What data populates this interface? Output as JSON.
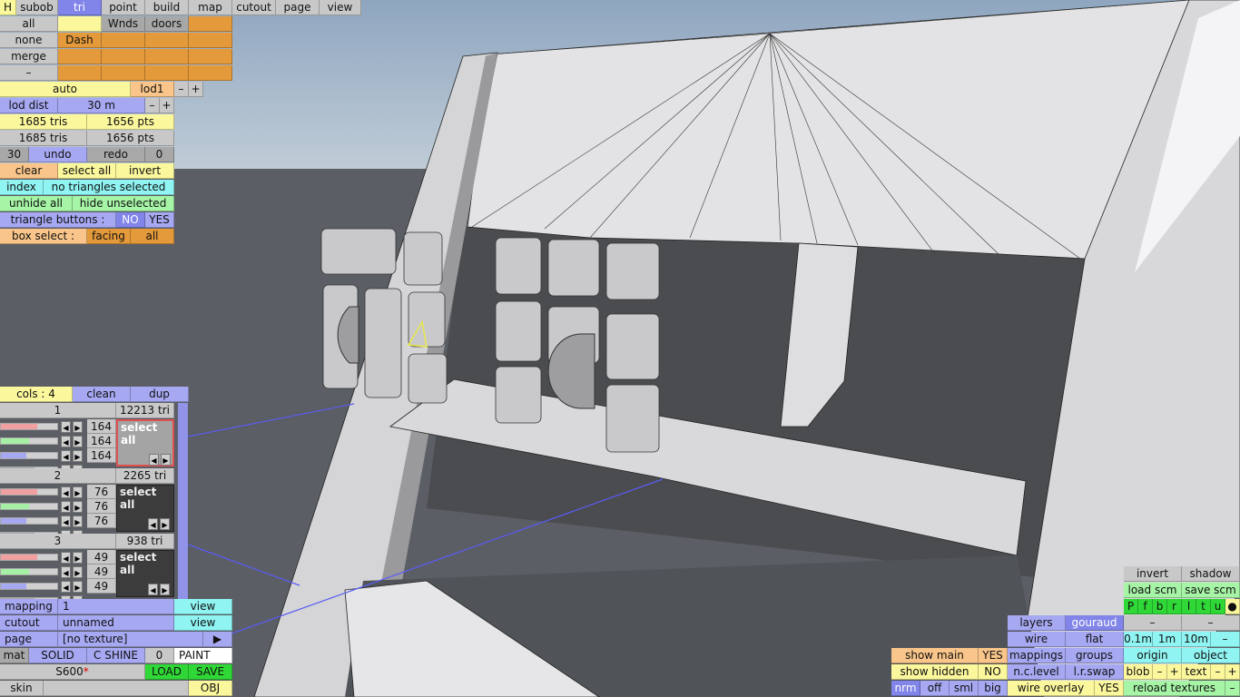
{
  "top_tabs": [
    "H",
    "subob",
    "tri",
    "point",
    "build",
    "map",
    "cutout",
    "page",
    "view"
  ],
  "sel_grid": {
    "all": "all",
    "wnds": "Wnds",
    "doors": "doors",
    "none": "none",
    "dash": "Dash",
    "merge": "merge",
    "minus": "–"
  },
  "lod": {
    "auto": "auto",
    "lod1": "lod1",
    "minus": "–",
    "plus": "+",
    "dist_label": "lod dist",
    "dist_value": "30 m"
  },
  "counts": {
    "tris1": "1685 tris",
    "pts1": "1656 pts",
    "tris2": "1685 tris",
    "pts2": "1656 pts"
  },
  "undo_row": {
    "num": "30",
    "undo": "undo",
    "redo": "redo",
    "zero": "0"
  },
  "sel_row": {
    "clear": "clear",
    "select_all": "select all",
    "invert": "invert"
  },
  "index_row": {
    "index": "index",
    "status": "no triangles selected"
  },
  "hide_row": {
    "unhide": "unhide all",
    "hide": "hide unselected"
  },
  "tri_buttons": {
    "label": "triangle buttons :",
    "no": "NO",
    "yes": "YES"
  },
  "box_select": {
    "label": "box select :",
    "facing": "facing",
    "all": "all"
  },
  "cols": {
    "label": "cols : 4",
    "clean": "clean",
    "dup": "dup"
  },
  "materials": [
    {
      "index": "1",
      "tris": "12213 tri",
      "v1": "164",
      "v2": "164",
      "v3": "164",
      "btn": "select all"
    },
    {
      "index": "2",
      "tris": "2265 tri",
      "v1": "76",
      "v2": "76",
      "v3": "76",
      "btn": "select all"
    },
    {
      "index": "3",
      "tris": "938 tri",
      "v1": "49",
      "v2": "49",
      "v3": "49",
      "btn": "select all"
    }
  ],
  "mapping": {
    "label": "mapping",
    "value": "1",
    "view": "view"
  },
  "cutout": {
    "label": "cutout",
    "value": "unnamed",
    "view": "view"
  },
  "page": {
    "label": "page",
    "value": "[no texture]",
    "arrow": "▶"
  },
  "mat_row": {
    "mat": "mat",
    "solid": "SOLID",
    "shine": "C SHINE",
    "zero": "0",
    "paint": "PAINT"
  },
  "file_row": {
    "name": "S600",
    "mark": "*",
    "load": "LOAD",
    "save": "SAVE"
  },
  "skin_row": {
    "skin": "skin",
    "obj": "OBJ"
  },
  "right_panel": {
    "invert": "invert",
    "shadow": "shadow",
    "load_scm": "load scm",
    "save_scm": "save scm",
    "letters": [
      "P",
      "f",
      "b",
      "r",
      "l",
      "t",
      "u",
      "●"
    ],
    "dash1": "–",
    "dash2": "–",
    "layers": "layers",
    "gouraud": "gouraud",
    "wire": "wire",
    "flat": "flat",
    "d01": "0.1m",
    "d1": "1m",
    "d10": "10m",
    "dminus": "–",
    "mappings": "mappings",
    "groups": "groups",
    "origin": "origin",
    "object": "object",
    "nc_level": "n.c.level",
    "lr_swap": "l.r.swap",
    "blob": "blob",
    "bm": "–",
    "bp": "+",
    "text": "text",
    "tm": "–",
    "tp": "+",
    "wire_overlay": "wire overlay",
    "wo_yes": "YES",
    "reload": "reload textures",
    "rdash": "–"
  },
  "bottom_panel": {
    "show_main": "show main",
    "sm_yes": "YES",
    "show_hidden": "show hidden",
    "sh_no": "NO",
    "nrm": "nrm",
    "off": "off",
    "sml": "sml",
    "big": "big"
  },
  "colors": {
    "blue": "#a6a8f2",
    "yellow": "#fbf79c",
    "orange": "#e49a3a",
    "cyan": "#8ff4f2",
    "green": "#a6f4a6"
  }
}
